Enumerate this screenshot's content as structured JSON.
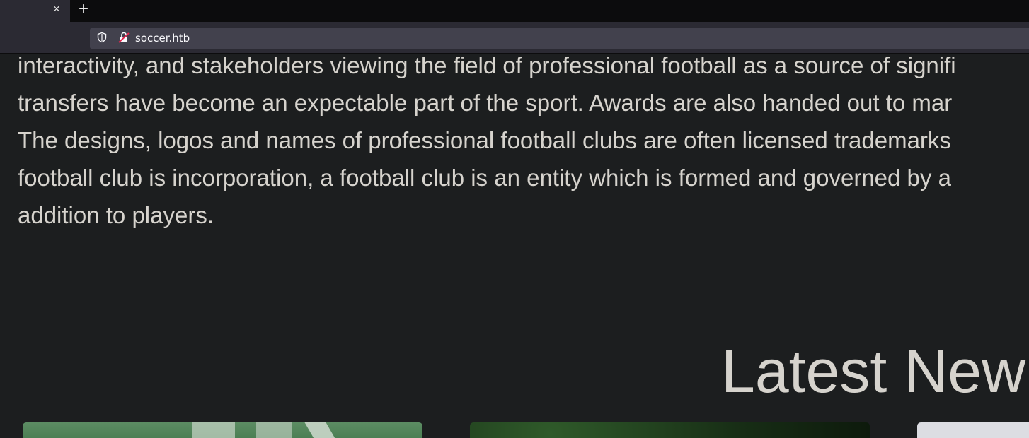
{
  "browser": {
    "tab_close_symbol": "×",
    "new_tab_symbol": "+",
    "url": "soccer.htb",
    "icons": [
      "shield-icon",
      "broken-lock-icon",
      "close-icon",
      "plus-icon"
    ]
  },
  "page": {
    "paragraph_lines": [
      "interactivity, and stakeholders viewing the field of professional football as a source of signifi",
      "transfers have become an expectable part of the sport. Awards are also handed out to mar",
      "The designs, logos and names of professional football clubs are often licensed trademarks",
      "football club is incorporation, a football club is an entity which is formed and governed by a",
      "addition to players."
    ],
    "news_heading": "Latest New",
    "cards": [
      "news-card-football-field",
      "news-card-aerial-forest",
      "news-card-light"
    ]
  },
  "colors": {
    "background": "#1c1e1f",
    "text": "#d6d3cd",
    "toolbar": "#2b2a33",
    "urlbar": "#42414d"
  }
}
